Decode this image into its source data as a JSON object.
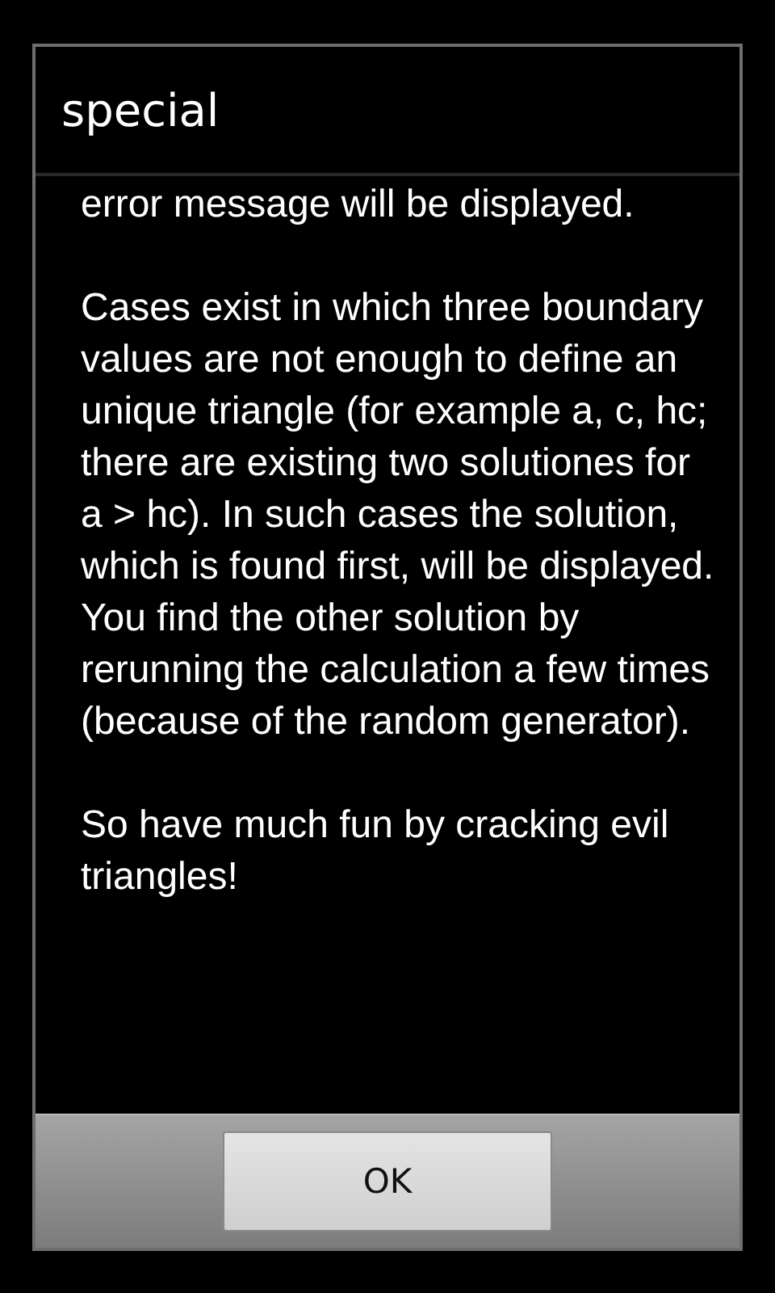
{
  "dialog": {
    "title": "special",
    "paragraphs": [
      "error message will be displayed.",
      "Cases exist in which three boundary values are not enough to define an unique triangle (for example a, c, hc; there are existing two solutiones for a > hc). In such cases the solution, which is found first, will be displayed. You find the other solution by rerunning the calculation a few times (because of the random generator).",
      "So have much fun by cracking evil triangles!"
    ],
    "buttons": [
      "OK"
    ]
  }
}
